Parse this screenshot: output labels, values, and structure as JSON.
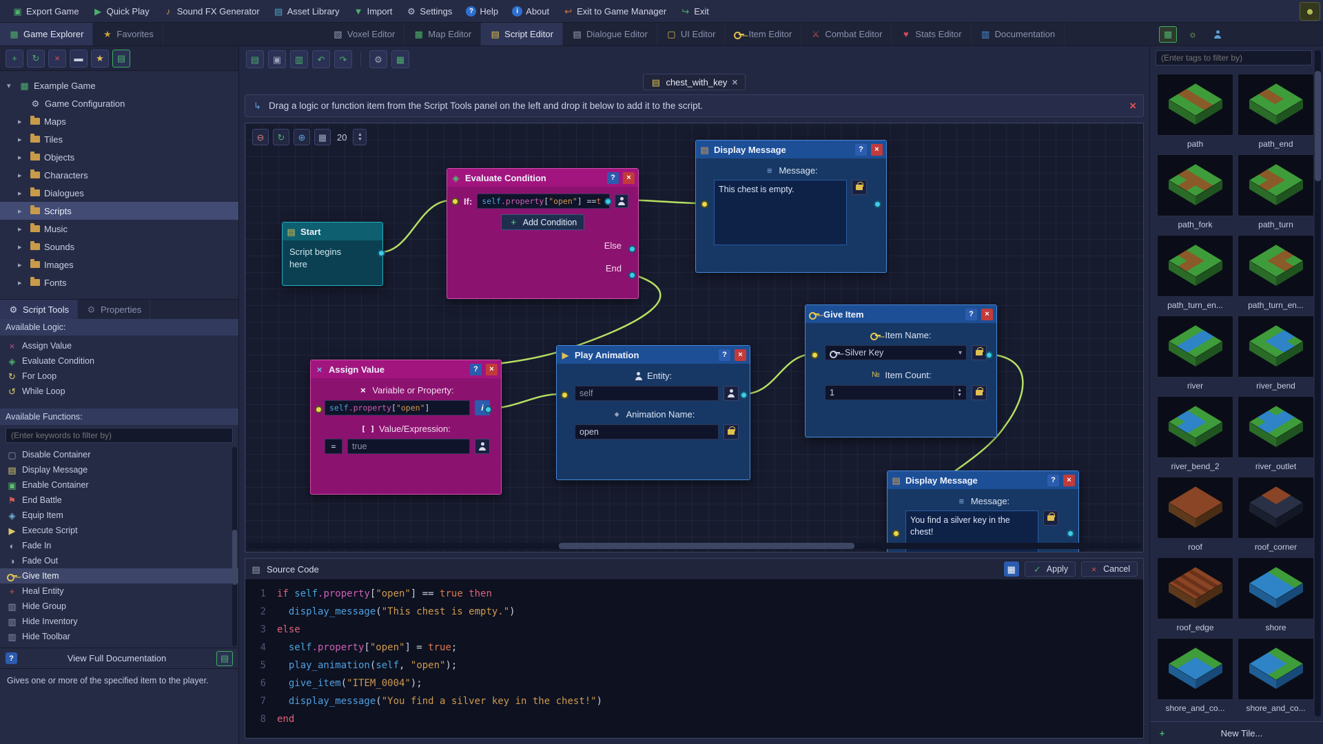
{
  "icons": {
    "help": "?",
    "close": "×",
    "add": "+",
    "check": "✓",
    "chevron_down": "▾",
    "chevron_right": "▸",
    "chevron_open": "▾",
    "up": "▲",
    "down": "▼",
    "menu": "≡",
    "scroll": "▤",
    "gear": "⚙",
    "grid": "▦",
    "note": "▤",
    "diamond": "◆",
    "x_mark": "×",
    "brackets": "[ ]",
    "num": "№",
    "mascot": "☻",
    "drag": "↳",
    "info_i": "i",
    "play": "▶"
  },
  "menu_bar": {
    "items": [
      {
        "id": "export-game",
        "label": "Export Game",
        "icon": "▣",
        "color": "#4caf6a"
      },
      {
        "id": "quick-play",
        "label": "Quick Play",
        "icon": "▶",
        "color": "#4caf6a"
      },
      {
        "id": "sound-fx-generator",
        "label": "Sound FX Generator",
        "icon": "♪",
        "color": "#d89a4a"
      },
      {
        "id": "asset-library",
        "label": "Asset Library",
        "icon": "▤",
        "color": "#4aa8c8"
      },
      {
        "id": "import",
        "label": "Import",
        "icon": "▼",
        "color": "#4caf6a"
      },
      {
        "id": "settings",
        "label": "Settings",
        "icon": "⚙",
        "color": "#b8c0d8"
      },
      {
        "id": "help",
        "label": "Help",
        "icon": "?",
        "color": "#ffffff",
        "badge": "#2e6fd0"
      },
      {
        "id": "about",
        "label": "About",
        "icon": "i",
        "color": "#ffffff",
        "badge": "#2e6fd0"
      },
      {
        "id": "exit-to-game-manager",
        "label": "Exit to Game Manager",
        "icon": "↩",
        "color": "#d87a3a"
      },
      {
        "id": "exit",
        "label": "Exit",
        "icon": "↪",
        "color": "#4caf6a"
      }
    ]
  },
  "tab_bar": {
    "left_tabs": [
      {
        "id": "game-explorer",
        "label": "Game Explorer",
        "icon": "▦",
        "color": "#4caf6a",
        "active": true
      },
      {
        "id": "favorites",
        "label": "Favorites",
        "icon": "★",
        "color": "#c8a03a",
        "active": false
      }
    ],
    "editor_tabs": [
      {
        "id": "voxel-editor",
        "label": "Voxel Editor",
        "icon": "▧",
        "color": "#9aa2ba",
        "active": false
      },
      {
        "id": "map-editor",
        "label": "Map Editor",
        "icon": "▦",
        "color": "#4caf6a",
        "active": false
      },
      {
        "id": "script-editor",
        "label": "Script Editor",
        "icon": "▤",
        "color": "#e0c050",
        "active": true
      },
      {
        "id": "dialogue-editor",
        "label": "Dialogue Editor",
        "icon": "▤",
        "color": "#9aa2ba",
        "active": false
      },
      {
        "id": "ui-editor",
        "label": "UI Editor",
        "icon": "▢",
        "color": "#d8b84a",
        "active": false
      },
      {
        "id": "item-editor",
        "label": "Item Editor",
        "icon": "key",
        "color": "#e0c050",
        "active": false
      },
      {
        "id": "combat-editor",
        "label": "Combat Editor",
        "icon": "⚔",
        "color": "#c05050",
        "active": false
      },
      {
        "id": "stats-editor",
        "label": "Stats Editor",
        "icon": "♥",
        "color": "#d04a5a",
        "active": false
      },
      {
        "id": "documentation",
        "label": "Documentation",
        "icon": "▥",
        "color": "#4a90d8",
        "active": false
      }
    ],
    "right_icons": [
      {
        "id": "tile-palette",
        "icon": "▦",
        "color": "#4caf6a",
        "active": true
      },
      {
        "id": "hints",
        "icon": "☼",
        "color": "#9adf5a",
        "active": false
      },
      {
        "id": "characters",
        "icon": "person",
        "color": "#5a9fd8",
        "active": false
      }
    ]
  },
  "explorer": {
    "toolbar": [
      {
        "id": "add",
        "icon": "+",
        "color": "#4caf6a"
      },
      {
        "id": "refresh",
        "icon": "↻",
        "color": "#4caf6a"
      },
      {
        "id": "delete",
        "icon": "×",
        "color": "#d85050"
      },
      {
        "id": "collapse-all",
        "icon": "▬",
        "color": "#c8cede"
      },
      {
        "id": "favorite",
        "icon": "★",
        "color": "#e0c050"
      },
      {
        "id": "toggle-labels",
        "icon": "▤",
        "color": "#4caf6a",
        "outlined": true
      }
    ],
    "root": {
      "label": "Example Game",
      "icon": "▦",
      "color": "#4caf6a"
    },
    "items": [
      {
        "label": "Game Configuration",
        "type": "config"
      },
      {
        "label": "Maps",
        "type": "folder"
      },
      {
        "label": "Tiles",
        "type": "folder"
      },
      {
        "label": "Objects",
        "type": "folder"
      },
      {
        "label": "Characters",
        "type": "folder"
      },
      {
        "label": "Dialogues",
        "type": "folder"
      },
      {
        "label": "Scripts",
        "type": "folder",
        "selected": true
      },
      {
        "label": "Music",
        "type": "folder"
      },
      {
        "label": "Sounds",
        "type": "folder"
      },
      {
        "label": "Images",
        "type": "folder"
      },
      {
        "label": "Fonts",
        "type": "folder"
      }
    ]
  },
  "tools": {
    "tabs": [
      {
        "label": "Script Tools",
        "active": true
      },
      {
        "label": "Properties",
        "active": false
      }
    ],
    "logic_header": "Available Logic:",
    "logic_items": [
      {
        "label": "Assign Value",
        "icon": "×",
        "color": "#d04a8a"
      },
      {
        "label": "Evaluate Condition",
        "icon": "◈",
        "color": "#4caf6a"
      },
      {
        "label": "For Loop",
        "icon": "↻",
        "color": "#d8c96a"
      },
      {
        "label": "While Loop",
        "icon": "↺",
        "color": "#d8c96a"
      }
    ],
    "functions_header": "Available Functions:",
    "filter_placeholder": "(Enter keywords to filter by)",
    "function_items": [
      {
        "label": "Disable Container",
        "icon": "▢",
        "color": "#8a92b0"
      },
      {
        "label": "Display Message",
        "icon": "▤",
        "color": "#d8c96a"
      },
      {
        "label": "Enable Container",
        "icon": "▣",
        "color": "#5cbf6a"
      },
      {
        "label": "End Battle",
        "icon": "⚑",
        "color": "#d05a5a"
      },
      {
        "label": "Equip Item",
        "icon": "◈",
        "color": "#6ab0d8"
      },
      {
        "label": "Execute Script",
        "icon": "▶",
        "color": "#d8c96a"
      },
      {
        "label": "Fade In",
        "icon": "◐",
        "color": "#9aa2c0"
      },
      {
        "label": "Fade Out",
        "icon": "◑",
        "color": "#9aa2c0"
      },
      {
        "label": "Give Item",
        "icon": "key",
        "color": "#e0c050",
        "selected": true
      },
      {
        "label": "Heal Entity",
        "icon": "+",
        "color": "#d05a5a"
      },
      {
        "label": "Hide Group",
        "icon": "▥",
        "color": "#8a92b0"
      },
      {
        "label": "Hide Inventory",
        "icon": "▥",
        "color": "#8a92b0"
      },
      {
        "label": "Hide Toolbar",
        "icon": "▥",
        "color": "#8a92b0"
      }
    ],
    "doc_button": "View Full Documentation",
    "description": "Gives one or more of the specified item to the player."
  },
  "editor": {
    "tab_label": "chest_with_key",
    "hint": "Drag a logic or function item from the Script Tools panel on the left and drop it below to add it to the script.",
    "grid_size": "20",
    "toolbar": [
      {
        "id": "new-script",
        "icon": "▤",
        "color": "#4caf6a"
      },
      {
        "id": "save",
        "icon": "▣",
        "color": "#9aa2ba"
      },
      {
        "id": "duplicate",
        "icon": "▥",
        "color": "#4caf6a"
      },
      {
        "id": "undo",
        "icon": "↶",
        "color": "#4caf6a"
      },
      {
        "id": "redo",
        "icon": "↷",
        "color": "#4caf6a"
      },
      {
        "id": "sep"
      },
      {
        "id": "settings",
        "icon": "⚙",
        "color": "#9aa2ba"
      },
      {
        "id": "export",
        "icon": "▦",
        "color": "#4caf6a"
      }
    ],
    "canvas_toolbar": [
      {
        "id": "zoom-out",
        "icon": "⊖",
        "color": "#d87a7a"
      },
      {
        "id": "reset-view",
        "icon": "↻",
        "color": "#4caf6a"
      },
      {
        "id": "zoom-in",
        "icon": "⊕",
        "color": "#5a9fd8"
      },
      {
        "id": "toggle-grid",
        "icon": "▦",
        "color": "#9aa2ba"
      }
    ]
  },
  "nodes": {
    "start": {
      "title": "Start",
      "body": "Script begins here"
    },
    "evaluate": {
      "title": "Evaluate Condition",
      "if_label": "If:",
      "add_condition": "Add Condition",
      "else_label": "Else",
      "end_label": "End",
      "condition_tokens": [
        {
          "c": "var",
          "t": "self"
        },
        {
          "c": "prop",
          "t": ".property"
        },
        {
          "c": "pun",
          "t": "["
        },
        {
          "c": "str",
          "t": "\"open\""
        },
        {
          "c": "pun",
          "t": "] == "
        },
        {
          "c": "bool",
          "t": "t"
        }
      ]
    },
    "display1": {
      "title": "Display Message",
      "message_label": "Message:",
      "message": "This chest is empty."
    },
    "assign": {
      "title": "Assign Value",
      "var_label": "Variable or Property:",
      "value_label": "Value/Expression:",
      "operator": "=",
      "value": "true",
      "var_tokens": [
        {
          "c": "var",
          "t": "self"
        },
        {
          "c": "prop",
          "t": ".property"
        },
        {
          "c": "pun",
          "t": "["
        },
        {
          "c": "str",
          "t": "\"open\""
        },
        {
          "c": "pun",
          "t": "]"
        }
      ]
    },
    "play": {
      "title": "Play Animation",
      "entity_label": "Entity:",
      "entity": "self",
      "anim_label": "Animation Name:",
      "anim": "open"
    },
    "give": {
      "title": "Give Item",
      "item_label": "Item Name:",
      "item": "Silver Key",
      "count_label": "Item Count:",
      "count": "1"
    },
    "display2": {
      "title": "Display Message",
      "message_label": "Message:",
      "message": "You find a silver key in the chest!"
    }
  },
  "source": {
    "title": "Source Code",
    "apply": "Apply",
    "cancel": "Cancel",
    "lines": [
      [
        {
          "c": "kw",
          "t": "if "
        },
        {
          "c": "var",
          "t": "self"
        },
        {
          "c": "prop",
          "t": ".property"
        },
        {
          "c": "pun",
          "t": "["
        },
        {
          "c": "str",
          "t": "\"open\""
        },
        {
          "c": "pun",
          "t": "] == "
        },
        {
          "c": "bool",
          "t": "true"
        },
        {
          "c": "kw",
          "t": " then"
        }
      ],
      [
        {
          "c": "pun",
          "t": "  "
        },
        {
          "c": "fn",
          "t": "display_message"
        },
        {
          "c": "pun",
          "t": "("
        },
        {
          "c": "str",
          "t": "\"This chest is empty.\""
        },
        {
          "c": "pun",
          "t": ")"
        }
      ],
      [
        {
          "c": "kw",
          "t": "else"
        }
      ],
      [
        {
          "c": "pun",
          "t": "  "
        },
        {
          "c": "var",
          "t": "self"
        },
        {
          "c": "prop",
          "t": ".property"
        },
        {
          "c": "pun",
          "t": "["
        },
        {
          "c": "str",
          "t": "\"open\""
        },
        {
          "c": "pun",
          "t": "] = "
        },
        {
          "c": "bool",
          "t": "true"
        },
        {
          "c": "pun",
          "t": ";"
        }
      ],
      [
        {
          "c": "pun",
          "t": "  "
        },
        {
          "c": "fn",
          "t": "play_animation"
        },
        {
          "c": "pun",
          "t": "("
        },
        {
          "c": "var",
          "t": "self"
        },
        {
          "c": "pun",
          "t": ", "
        },
        {
          "c": "str",
          "t": "\"open\""
        },
        {
          "c": "pun",
          "t": ");"
        }
      ],
      [
        {
          "c": "pun",
          "t": "  "
        },
        {
          "c": "fn",
          "t": "give_item"
        },
        {
          "c": "pun",
          "t": "("
        },
        {
          "c": "str",
          "t": "\"ITEM_0004\""
        },
        {
          "c": "pun",
          "t": ");"
        }
      ],
      [
        {
          "c": "pun",
          "t": "  "
        },
        {
          "c": "fn",
          "t": "display_message"
        },
        {
          "c": "pun",
          "t": "("
        },
        {
          "c": "str",
          "t": "\"You find a silver key in the chest!\""
        },
        {
          "c": "pun",
          "t": ")"
        }
      ],
      [
        {
          "c": "kw",
          "t": "end"
        }
      ]
    ]
  },
  "tiles": {
    "filter_placeholder": "(Enter tags to filter by)",
    "new_tile": "New Tile...",
    "items": [
      {
        "name": "path",
        "art": "path-straight"
      },
      {
        "name": "path_end",
        "art": "path-end"
      },
      {
        "name": "path_fork",
        "art": "path-fork"
      },
      {
        "name": "path_turn",
        "art": "path-turn"
      },
      {
        "name": "path_turn_en...",
        "art": "path-turn"
      },
      {
        "name": "path_turn_en...",
        "art": "path-turn-2"
      },
      {
        "name": "river",
        "art": "river-straight"
      },
      {
        "name": "river_bend",
        "art": "river-bend"
      },
      {
        "name": "river_bend_2",
        "art": "river-bend-2"
      },
      {
        "name": "river_outlet",
        "art": "river-outlet"
      },
      {
        "name": "roof",
        "art": "roof-flat"
      },
      {
        "name": "roof_corner",
        "art": "roof-corner"
      },
      {
        "name": "roof_edge",
        "art": "roof-edge"
      },
      {
        "name": "shore",
        "art": "shore"
      },
      {
        "name": "shore_and_co...",
        "art": "shore-corner"
      },
      {
        "name": "shore_and_co...",
        "art": "shore-corner-2"
      }
    ]
  }
}
